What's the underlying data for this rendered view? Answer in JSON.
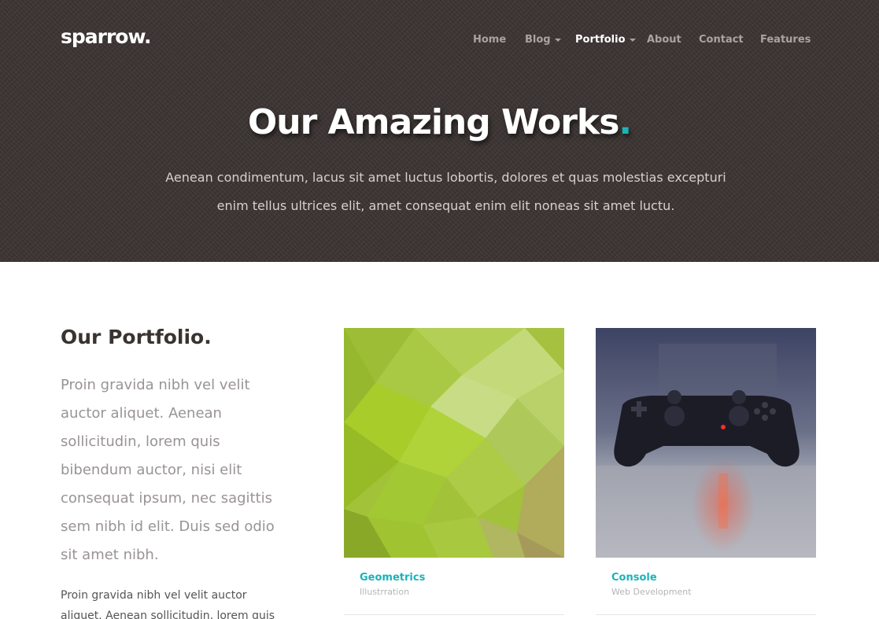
{
  "header": {
    "logo": "sparrow.",
    "nav": [
      {
        "label": "Home",
        "active": false,
        "dropdown": false
      },
      {
        "label": "Blog",
        "active": false,
        "dropdown": true
      },
      {
        "label": "Portfolio",
        "active": true,
        "dropdown": true
      },
      {
        "label": "About",
        "active": false,
        "dropdown": false
      },
      {
        "label": "Contact",
        "active": false,
        "dropdown": false
      },
      {
        "label": "Features",
        "active": false,
        "dropdown": false
      }
    ]
  },
  "hero": {
    "title": "Our Amazing Works",
    "title_dot": ".",
    "subtitle": "Aenean condimentum, lacus sit amet luctus lobortis, dolores et quas molestias excepturi enim tellus ultrices elit, amet consequat enim elit noneas sit amet luctu."
  },
  "portfolio": {
    "heading": "Our Portfolio.",
    "lead": "Proin gravida nibh vel velit auctor aliquet. Aenean sollicitudin, lorem quis bibendum auctor, nisi elit consequat ipsum, nec sagittis sem nibh id elit. Duis sed odio sit amet nibh.",
    "body": "Proin gravida nibh vel velit auctor aliquet. Aenean sollicitudin, lorem quis",
    "items": [
      {
        "title": "Geometrics",
        "category": "Illustrration",
        "image": "green-polygon-image"
      },
      {
        "title": "Console",
        "category": "Web Development",
        "image": "game-controller-photo"
      }
    ]
  },
  "colors": {
    "accent": "#1ab3b8",
    "hero_bg": "#3b3432",
    "nav_text": "#a9a3a1",
    "heading": "#3a3330"
  }
}
